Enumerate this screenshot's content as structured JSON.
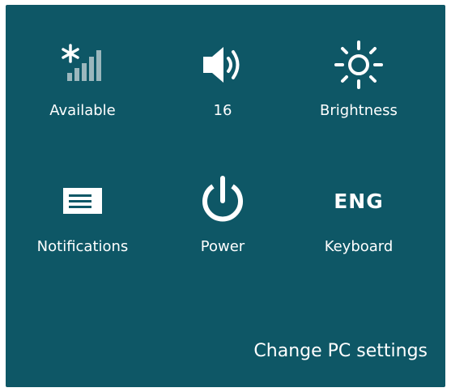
{
  "panel": {
    "background": "#0e5766",
    "tiles": [
      {
        "icon": "network-signal-icon",
        "label": "Available"
      },
      {
        "icon": "speaker-volume-icon",
        "label": "16"
      },
      {
        "icon": "brightness-sun-icon",
        "label": "Brightness"
      },
      {
        "icon": "notifications-icon",
        "label": "Notifications"
      },
      {
        "icon": "power-icon",
        "label": "Power"
      },
      {
        "icon": "keyboard-language-icon",
        "icon_text": "ENG",
        "label": "Keyboard"
      }
    ],
    "change_settings": "Change PC settings"
  }
}
